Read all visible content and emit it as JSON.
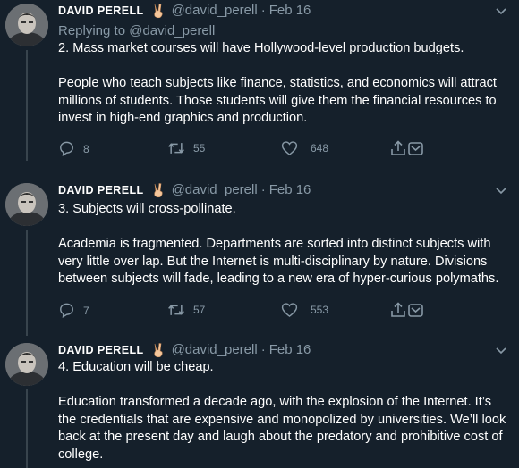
{
  "tweets": [
    {
      "name": "DAVID PERELL",
      "handle": "@david_perell",
      "separator": "·",
      "date": "Feb 16",
      "replying_to": "Replying to @david_perell",
      "paragraphs": [
        "2. Mass market courses will have Hollywood-level production budgets.",
        "People who teach subjects like finance, statistics, and economics will attract millions of students. Those students will give them the financial resources to invest in high-end graphics and production."
      ],
      "stats": {
        "replies": "8",
        "retweets": "55",
        "likes": "648"
      }
    },
    {
      "name": "DAVID PERELL",
      "handle": "@david_perell",
      "separator": "·",
      "date": "Feb 16",
      "paragraphs": [
        "3. Subjects will cross-pollinate.",
        "Academia is fragmented. Departments are sorted into distinct subjects with very little over lap. But the Internet is multi-disciplinary by nature. Divisions between subjects will fade, leading to a new era of hyper-curious polymaths."
      ],
      "stats": {
        "replies": "7",
        "retweets": "57",
        "likes": "553"
      }
    },
    {
      "name": "DAVID PERELL",
      "handle": "@david_perell",
      "separator": "·",
      "date": "Feb 16",
      "paragraphs": [
        "4. Education will be cheap.",
        "Education transformed a decade ago, with the explosion of the Internet. It’s the credentials that are expensive and monopolized by universities. We’ll look back at the present day and laugh about the predatory and prohibitive cost of college."
      ]
    }
  ],
  "icons": {
    "more": "chevron-down-icon",
    "reply": "comment-icon",
    "retweet": "retweet-icon",
    "like": "heart-icon",
    "share": "share-icon",
    "emoji": "victory-hand-icon"
  },
  "colors": {
    "background": "#15202b",
    "muted": "#8899a6",
    "text": "#ffffff",
    "divider": "#38444d"
  }
}
